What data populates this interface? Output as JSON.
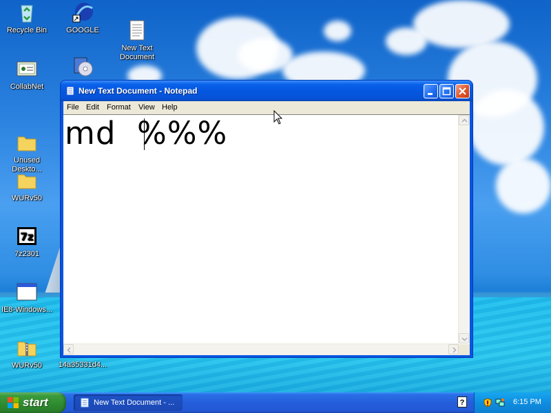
{
  "desktop": {
    "icons": [
      {
        "label": "Recycle Bin",
        "icon": "recycle-bin-icon"
      },
      {
        "label": "GOOGLE",
        "icon": "google-shortcut-icon"
      },
      {
        "label": "New Text\nDocument",
        "icon": "text-document-icon"
      },
      {
        "label": "CollabNet",
        "icon": "collabnet-icon"
      },
      {
        "label": "",
        "icon": "installer-cd-icon"
      },
      {
        "label": "Unused\nDeskto...",
        "icon": "folder-icon"
      },
      {
        "label": "WURv50",
        "icon": "folder-icon"
      },
      {
        "label": "7z2301",
        "icon": "7zip-icon"
      },
      {
        "label": "IE8-Windows...",
        "icon": "application-window-icon"
      },
      {
        "label": "WURv50",
        "icon": "zip-folder-icon"
      },
      {
        "label": "14a35331d4...",
        "icon": "file-icon"
      }
    ]
  },
  "window": {
    "title": "New Text Document - Notepad",
    "menu": [
      "File",
      "Edit",
      "Format",
      "View",
      "Help"
    ],
    "content": "md  %%%"
  },
  "taskbar": {
    "start_label": "start",
    "task_label": "New Text Document - ...",
    "clock": "6:15 PM"
  },
  "colors": {
    "title_bar": "#0554d8",
    "taskbar": "#245edb",
    "start_button": "#3c9b3c",
    "close_button": "#e0562a"
  }
}
